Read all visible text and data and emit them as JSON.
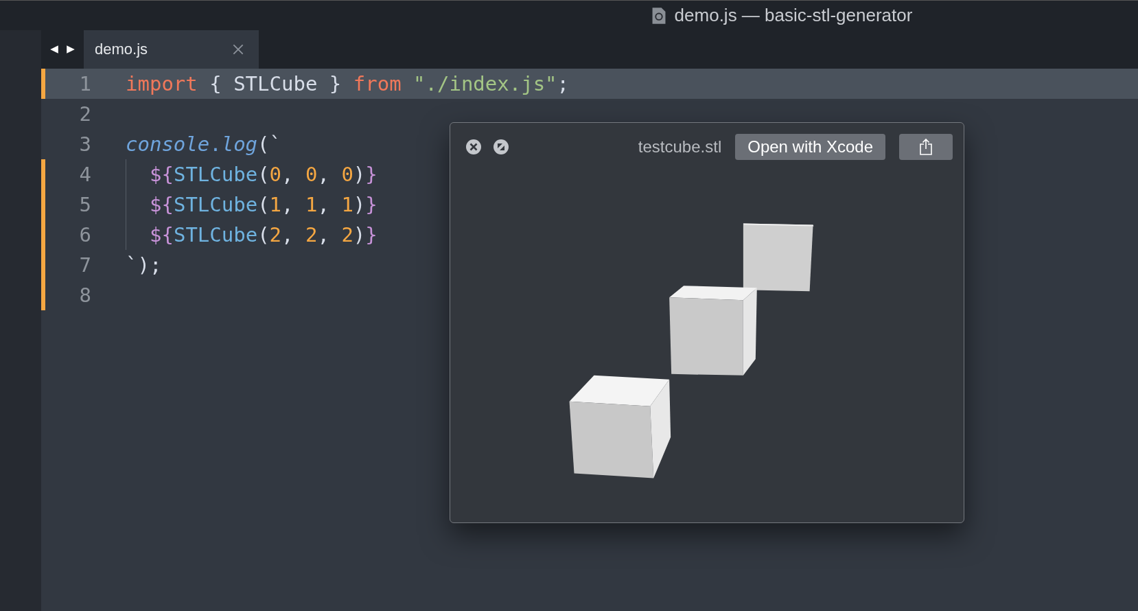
{
  "window": {
    "title": "demo.js — basic-stl-generator"
  },
  "tabs": [
    {
      "label": "demo.js",
      "selected": true
    }
  ],
  "editor": {
    "lines": [
      {
        "number": "1",
        "current": true,
        "modified": true,
        "tokens": [
          {
            "kind": "keyword",
            "text": "import"
          },
          {
            "kind": "plain",
            "text": " { STLCube } "
          },
          {
            "kind": "keyword",
            "text": "from "
          },
          {
            "kind": "string",
            "text": "\"./index.js\""
          },
          {
            "kind": "plain",
            "text": ";"
          }
        ]
      },
      {
        "number": "2",
        "current": false,
        "modified": false
      },
      {
        "number": "3",
        "current": false,
        "modified": false,
        "tokens": [
          {
            "kind": "object",
            "text": "console"
          },
          {
            "kind": "punct",
            "text": "."
          },
          {
            "kind": "object",
            "text": "log"
          },
          {
            "kind": "plain",
            "text": "(`"
          }
        ]
      },
      {
        "number": "4",
        "current": false,
        "modified": true,
        "indent": true,
        "tokens": [
          {
            "kind": "template",
            "text": "${"
          },
          {
            "kind": "function",
            "text": "STLCube"
          },
          {
            "kind": "plain",
            "text": "("
          },
          {
            "kind": "number",
            "text": "0"
          },
          {
            "kind": "plain",
            "text": ", "
          },
          {
            "kind": "number",
            "text": "0"
          },
          {
            "kind": "plain",
            "text": ", "
          },
          {
            "kind": "number",
            "text": "0"
          },
          {
            "kind": "plain",
            "text": ")"
          },
          {
            "kind": "template",
            "text": "}"
          }
        ]
      },
      {
        "number": "5",
        "current": false,
        "modified": true,
        "indent": true,
        "tokens": [
          {
            "kind": "template",
            "text": "${"
          },
          {
            "kind": "function",
            "text": "STLCube"
          },
          {
            "kind": "plain",
            "text": "("
          },
          {
            "kind": "number",
            "text": "1"
          },
          {
            "kind": "plain",
            "text": ", "
          },
          {
            "kind": "number",
            "text": "1"
          },
          {
            "kind": "plain",
            "text": ", "
          },
          {
            "kind": "number",
            "text": "1"
          },
          {
            "kind": "plain",
            "text": ")"
          },
          {
            "kind": "template",
            "text": "}"
          }
        ]
      },
      {
        "number": "6",
        "current": false,
        "modified": true,
        "indent": true,
        "tokens": [
          {
            "kind": "template",
            "text": "${"
          },
          {
            "kind": "function",
            "text": "STLCube"
          },
          {
            "kind": "plain",
            "text": "("
          },
          {
            "kind": "number",
            "text": "2"
          },
          {
            "kind": "plain",
            "text": ", "
          },
          {
            "kind": "number",
            "text": "2"
          },
          {
            "kind": "plain",
            "text": ", "
          },
          {
            "kind": "number",
            "text": "2"
          },
          {
            "kind": "plain",
            "text": ")"
          },
          {
            "kind": "template",
            "text": "}"
          }
        ]
      },
      {
        "number": "7",
        "current": false,
        "modified": true,
        "tokens": [
          {
            "kind": "plain",
            "text": "`);"
          }
        ]
      },
      {
        "number": "8",
        "current": false,
        "modified": true
      }
    ]
  },
  "quicklook": {
    "filename": "testcube.stl",
    "open_button": "Open with Xcode"
  }
}
